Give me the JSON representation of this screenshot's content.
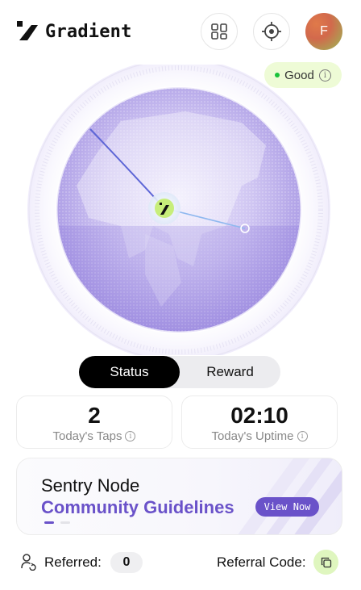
{
  "header": {
    "brand": "Gradient",
    "avatar_initial": "F"
  },
  "status": {
    "label": "Good",
    "info": "i",
    "color": "#19c23a"
  },
  "tabs": [
    {
      "label": "Status",
      "active": true
    },
    {
      "label": "Reward",
      "active": false
    }
  ],
  "stats": {
    "taps": {
      "value": "2",
      "label": "Today's Taps",
      "info": "i"
    },
    "uptime": {
      "value": "02:10",
      "label": "Today's Uptime",
      "info": "i"
    }
  },
  "banner": {
    "title": "Sentry Node",
    "subtitle": "Community Guidelines",
    "button": "View Now",
    "active_slide": 1,
    "slide_count": 2
  },
  "footer": {
    "referred_label": "Referred:",
    "referred_count": "0",
    "referral_code_label": "Referral Code:"
  },
  "colors": {
    "accent": "#6a52c9",
    "lime": "#dff6bf",
    "status_pill": "#eefbd6"
  },
  "icons": [
    "gradient-logo",
    "apps-grid-icon",
    "target-icon",
    "info-icon",
    "user-refresh-icon",
    "copy-icon"
  ]
}
